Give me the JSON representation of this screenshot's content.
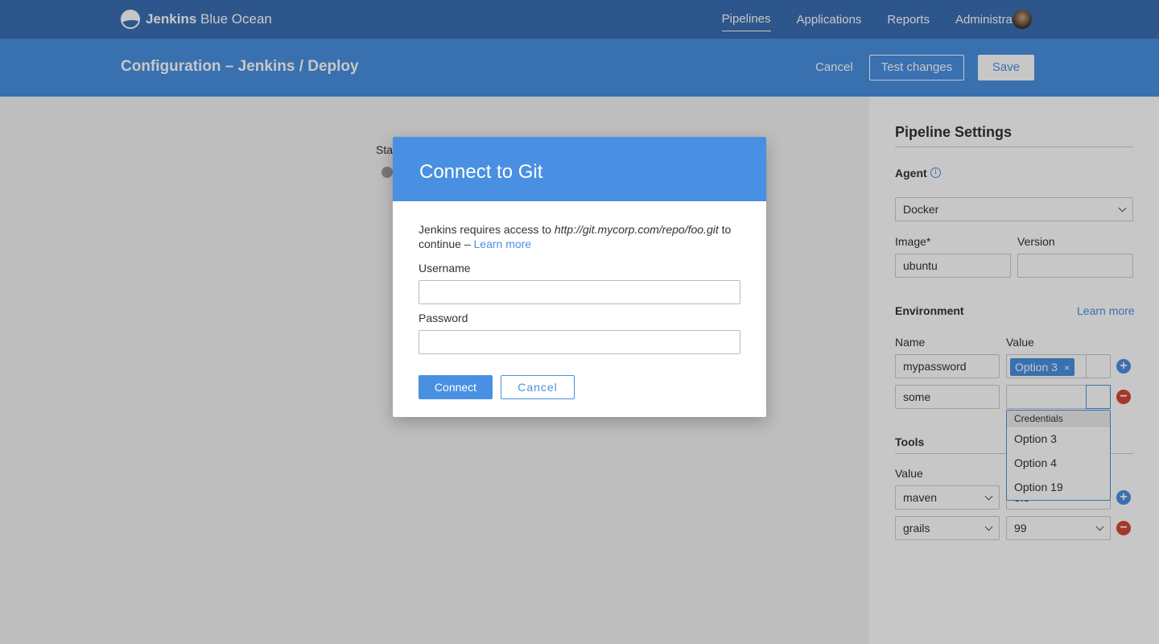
{
  "brand": {
    "bold": "Jenkins",
    "rest": " Blue Ocean"
  },
  "nav": {
    "items": [
      "Pipelines",
      "Applications",
      "Reports",
      "Administration"
    ]
  },
  "header": {
    "title": "Configuration – Jenkins / Deploy",
    "cancel": "Cancel",
    "test_changes": "Test changes",
    "save": "Save"
  },
  "canvas": {
    "stage_label": "Start"
  },
  "panel": {
    "title": "Pipeline Settings",
    "agent": {
      "label": "Agent",
      "value": "Docker"
    },
    "image": {
      "label": "Image*",
      "value": "ubuntu"
    },
    "version": {
      "label": "Version",
      "value": ""
    },
    "environment": {
      "label": "Environment",
      "learn_more": "Learn more",
      "name_header": "Name",
      "value_header": "Value",
      "rows": [
        {
          "name": "mypassword",
          "value_tag": "Option 3"
        },
        {
          "name": "some",
          "value_tag": ""
        }
      ]
    },
    "credentials_dropdown": {
      "group": "Credentials",
      "options": [
        "Option 3",
        "Option 4",
        "Option 19"
      ]
    },
    "tools": {
      "label": "Tools",
      "value_header": "Value",
      "rows": [
        {
          "tool": "maven",
          "version": "3.3"
        },
        {
          "tool": "grails",
          "version": "99"
        }
      ]
    }
  },
  "modal": {
    "title": "Connect to Git",
    "desc_prefix": "Jenkins requires access to ",
    "desc_url": "http://git.mycorp.com/repo/foo.git",
    "desc_suffix": " to continue – ",
    "learn_more": "Learn more",
    "username_label": "Username",
    "username_value": "",
    "password_label": "Password",
    "password_value": "",
    "connect": "Connect",
    "cancel": "Cancel"
  },
  "colors": {
    "topbar": "#3a6fb4",
    "accent": "#4a90e2",
    "danger": "#d24939"
  }
}
